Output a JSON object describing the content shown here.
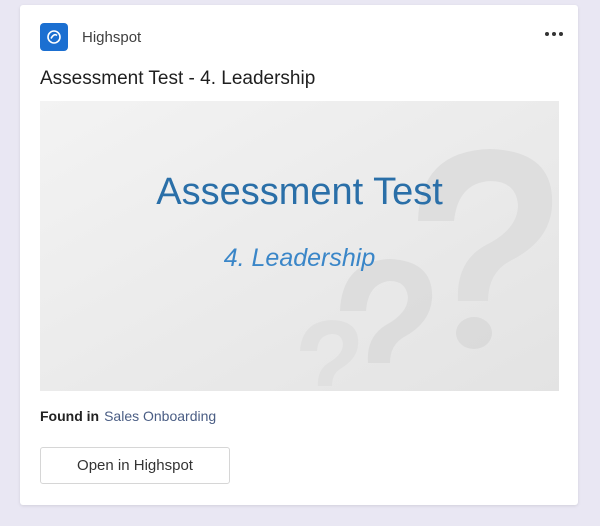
{
  "app": {
    "name": "Highspot",
    "logo_icon": "highspot-logo-icon",
    "more_icon": "more-options-icon",
    "accent": "#1b6fd1"
  },
  "card": {
    "title": "Assessment Test - 4. Leadership"
  },
  "thumbnail": {
    "title": "Assessment Test",
    "subtitle": "4. Leadership",
    "background_icon": "question-marks-icon",
    "title_color": "#2a6fa8",
    "subtitle_color": "#3a86c8"
  },
  "found_in": {
    "label": "Found in",
    "location": "Sales Onboarding"
  },
  "actions": {
    "open_label": "Open in Highspot"
  }
}
